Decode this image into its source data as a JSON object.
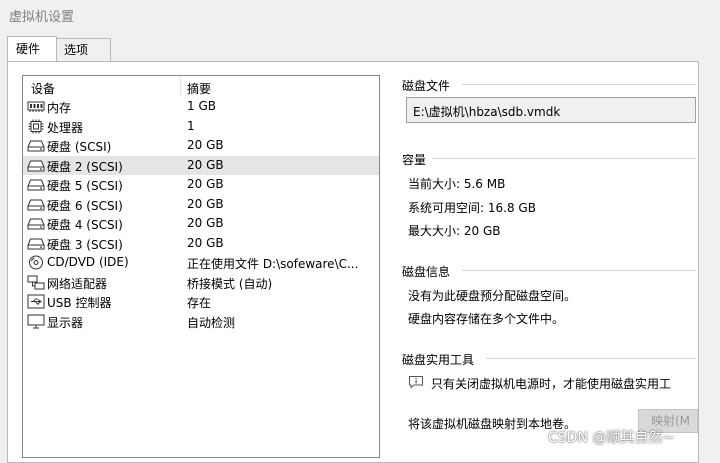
{
  "window": {
    "title": "虚拟机设置"
  },
  "tabs": [
    {
      "label": "硬件",
      "active": true
    },
    {
      "label": "选项",
      "active": false
    }
  ],
  "device_list": {
    "headers": {
      "device": "设备",
      "summary": "摘要"
    },
    "items": [
      {
        "icon": "memory-icon",
        "name": "内存",
        "summary": "1 GB",
        "selected": false
      },
      {
        "icon": "cpu-icon",
        "name": "处理器",
        "summary": "1",
        "selected": false
      },
      {
        "icon": "disk-icon",
        "name": "硬盘 (SCSI)",
        "summary": "20 GB",
        "selected": false
      },
      {
        "icon": "disk-icon",
        "name": "硬盘 2 (SCSI)",
        "summary": "20 GB",
        "selected": true
      },
      {
        "icon": "disk-icon",
        "name": "硬盘 5 (SCSI)",
        "summary": "20 GB",
        "selected": false
      },
      {
        "icon": "disk-icon",
        "name": "硬盘 6 (SCSI)",
        "summary": "20 GB",
        "selected": false
      },
      {
        "icon": "disk-icon",
        "name": "硬盘 4 (SCSI)",
        "summary": "20 GB",
        "selected": false
      },
      {
        "icon": "disk-icon",
        "name": "硬盘 3 (SCSI)",
        "summary": "20 GB",
        "selected": false
      },
      {
        "icon": "cd-dvd-icon",
        "name": "CD/DVD (IDE)",
        "summary": "正在使用文件 D:\\sofeware\\C...",
        "selected": false
      },
      {
        "icon": "network-adapter-icon",
        "name": "网络适配器",
        "summary": "桥接模式 (自动)",
        "selected": false
      },
      {
        "icon": "usb-icon",
        "name": "USB 控制器",
        "summary": "存在",
        "selected": false
      },
      {
        "icon": "monitor-icon",
        "name": "显示器",
        "summary": "自动检测",
        "selected": false
      }
    ]
  },
  "disk_file": {
    "title": "磁盘文件",
    "path": "E:\\虚拟机\\hbza\\sdb.vmdk"
  },
  "capacity": {
    "title": "容量",
    "current_size": "当前大小: 5.6 MB",
    "available_space": "系统可用空间: 16.8 GB",
    "max_size": "最大大小: 20 GB"
  },
  "disk_info": {
    "title": "磁盘信息",
    "line1": "没有为此硬盘预分配磁盘空间。",
    "line2": "硬盘内容存储在多个文件中。"
  },
  "disk_utilities": {
    "title": "磁盘实用工具",
    "notice": "只有关闭虚拟机电源时，才能使用磁盘实用工",
    "map_text": "将该虚拟机磁盘映射到本地卷。",
    "map_button": "映射(M"
  },
  "watermark": "CSDN @顺其自然~"
}
